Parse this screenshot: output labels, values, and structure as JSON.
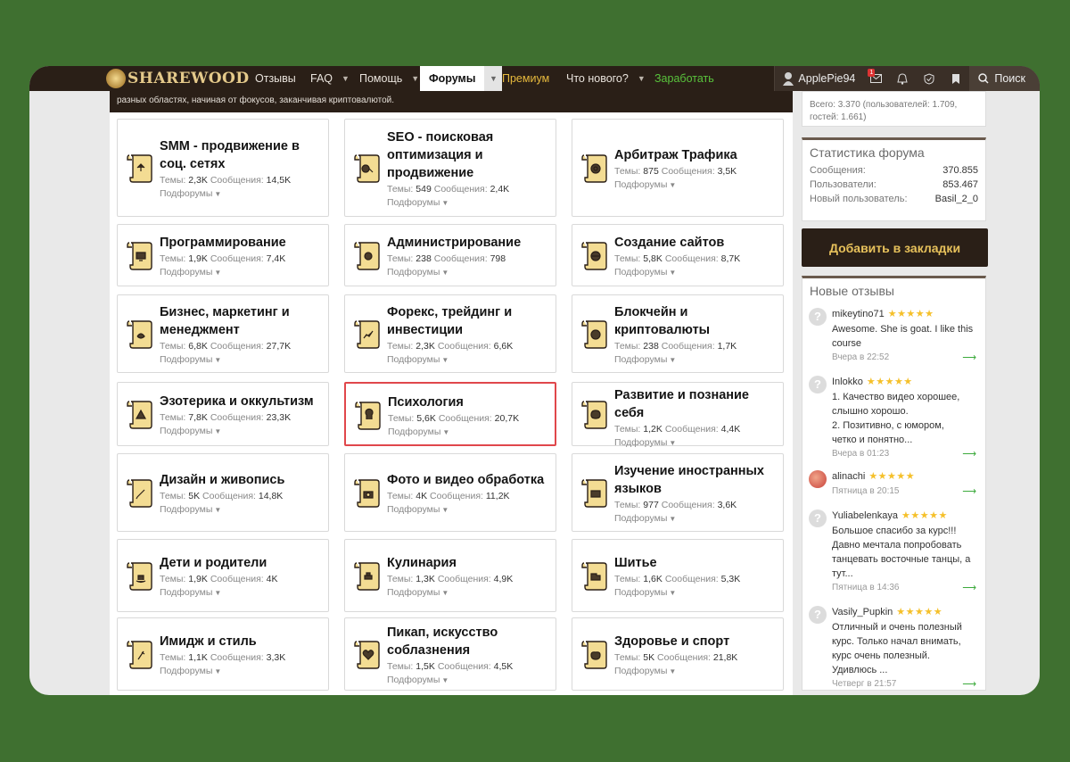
{
  "nav": {
    "logo": "SHAREWOOD",
    "items": [
      {
        "label": "Отзывы"
      },
      {
        "label": "FAQ"
      },
      {
        "label": "Помощь"
      },
      {
        "label": "Форумы"
      },
      {
        "label": "Премиум"
      },
      {
        "label": "Что нового?"
      },
      {
        "label": "Заработать"
      }
    ],
    "username": "ApplePie94",
    "notif_count": "1",
    "search_label": "Поиск"
  },
  "banner_text": "разных областях, начиная от фокусов, заканчивая криптовалютой.",
  "common": {
    "topics_label": "Темы:",
    "messages_label": "Сообщения:",
    "subforums_label": "Подфорумы"
  },
  "forums": [
    {
      "title": "SMM - продвижение в соц. сетях",
      "topics": "2,3K",
      "messages": "14,5K",
      "icon": "smm-icon"
    },
    {
      "title": "SEO - поисковая оптимизация и продвижение",
      "topics": "549",
      "messages": "2,4K",
      "icon": "seo-icon"
    },
    {
      "title": "Арбитраж Трафика",
      "topics": "875",
      "messages": "3,5K",
      "icon": "target-icon"
    },
    {
      "title": "Программирование",
      "topics": "1,9K",
      "messages": "7,4K",
      "icon": "programming-icon"
    },
    {
      "title": "Администрирование",
      "topics": "238",
      "messages": "798",
      "icon": "admin-icon"
    },
    {
      "title": "Создание сайтов",
      "topics": "5,8K",
      "messages": "8,7K",
      "icon": "www-icon"
    },
    {
      "title": "Бизнес, маркетинг и менеджмент",
      "topics": "6,8K",
      "messages": "27,7K",
      "icon": "business-icon"
    },
    {
      "title": "Форекс, трейдинг и инвестиции",
      "topics": "2,3K",
      "messages": "6,6K",
      "icon": "forex-icon"
    },
    {
      "title": "Блокчейн и криптовалюты",
      "topics": "238",
      "messages": "1,7K",
      "icon": "bitcoin-icon"
    },
    {
      "title": "Эзотерика и оккультизм",
      "topics": "7,8K",
      "messages": "23,3K",
      "icon": "esoteric-icon"
    },
    {
      "title": "Психология",
      "topics": "5,6K",
      "messages": "20,7K",
      "icon": "psychology-icon"
    },
    {
      "title": "Развитие и познание себя",
      "topics": "1,2K",
      "messages": "4,4K",
      "icon": "brain-icon"
    },
    {
      "title": "Дизайн и живопись",
      "topics": "5K",
      "messages": "14,8K",
      "icon": "design-icon"
    },
    {
      "title": "Фото и видео обработка",
      "topics": "4K",
      "messages": "11,2K",
      "icon": "camera-icon"
    },
    {
      "title": "Изучение иностранных языков",
      "topics": "977",
      "messages": "3,6K",
      "icon": "languages-icon"
    },
    {
      "title": "Дети и родители",
      "topics": "1,9K",
      "messages": "4K",
      "icon": "rocking-horse-icon"
    },
    {
      "title": "Кулинария",
      "topics": "1,3K",
      "messages": "4,9K",
      "icon": "cooking-icon"
    },
    {
      "title": "Шитье",
      "topics": "1,6K",
      "messages": "5,3K",
      "icon": "sewing-icon"
    },
    {
      "title": "Имидж и стиль",
      "topics": "1,1K",
      "messages": "3,3K",
      "icon": "style-icon"
    },
    {
      "title": "Пикап, искусство соблазнения",
      "topics": "1,5K",
      "messages": "4,5K",
      "icon": "heart-icon"
    },
    {
      "title": "Здоровье и спорт",
      "topics": "5K",
      "messages": "21,8K",
      "icon": "apple-icon"
    }
  ],
  "sidebar": {
    "online_text_1": "Всего: 3.370 (пользователей: 1.709,",
    "online_text_2": "гостей: 1.661)",
    "stats_title": "Статистика форума",
    "stats": [
      {
        "label": "Сообщения:",
        "value": "370.855"
      },
      {
        "label": "Пользователи:",
        "value": "853.467"
      },
      {
        "label": "Новый пользователь:",
        "value": "Basil_2_0"
      }
    ],
    "bookmark_label": "Добавить в закладки",
    "reviews_title": "Новые отзывы",
    "stars": "★★★★★",
    "reviews": [
      {
        "name": "mikeytino71",
        "lines": [
          "Awesome. She is goat. I like this",
          "course"
        ],
        "date": "Вчера в 22:52"
      },
      {
        "name": "Inlokko",
        "lines": [
          "1. Качество видео хорошее,",
          "слышно хорошо.",
          "2. Позитивно, с юмором,",
          "четко и понятно..."
        ],
        "date": "Вчера в 01:23"
      },
      {
        "name": "alinachi",
        "lines": [],
        "date": "Пятница в 20:15"
      },
      {
        "name": "Yuliabelenkaya",
        "lines": [
          "Большое спасибо за курс!!!",
          "Давно мечтала попробовать",
          "танцевать восточные танцы, а",
          "тут..."
        ],
        "date": "Пятница в 14:36"
      },
      {
        "name": "Vasily_Pupkin",
        "lines": [
          "Отличный и очень полезный",
          "курс. Только начал внимать,",
          "курс очень полезный.",
          "Удивлюсь ..."
        ],
        "date": "Четверг в 21:57"
      }
    ]
  }
}
